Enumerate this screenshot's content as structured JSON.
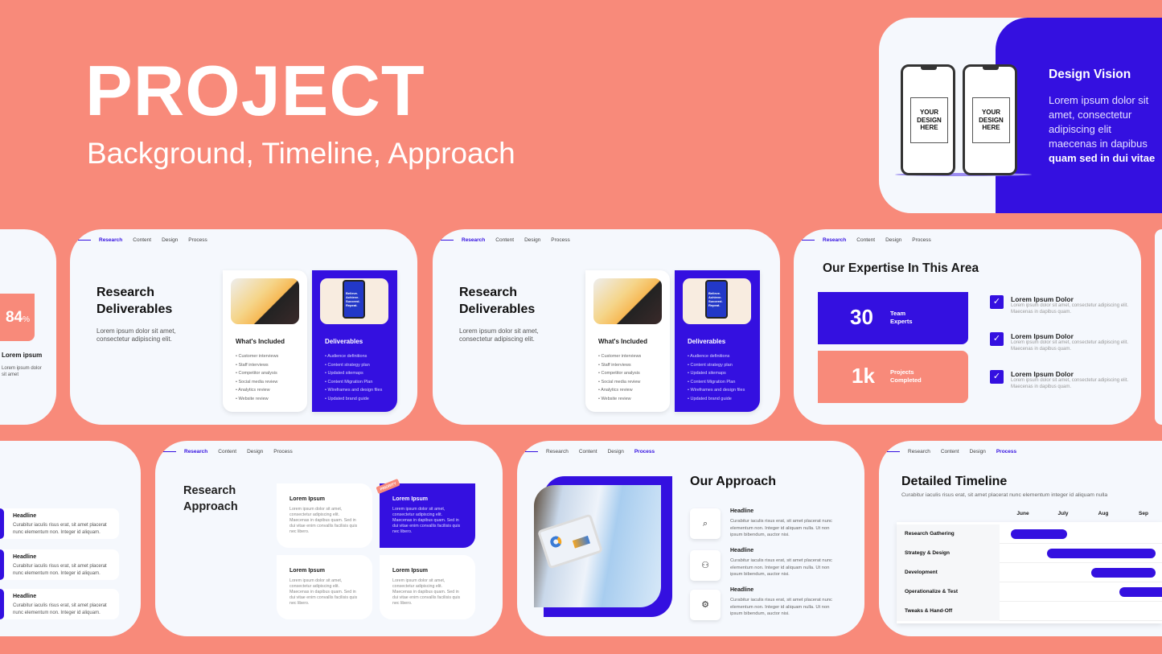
{
  "colors": {
    "background": "#F88A7A",
    "accent": "#3410E0",
    "slide": "#F5F8FD"
  },
  "hero": {
    "title": "PROJECT",
    "subtitle": "Background, Timeline, Approach"
  },
  "nav": {
    "research": "Research",
    "content": "Content",
    "design": "Design",
    "process": "Process"
  },
  "design_vision": {
    "placeholder": "YOUR DESIGN HERE",
    "title": "Design Vision",
    "body": "Lorem ipsum dolor sit amet, consectetur adipiscing elit maecenas in dapibus",
    "body_bold": "quam sed in dui vitae"
  },
  "stat_partial": {
    "value": "84",
    "unit": "%",
    "title": "Lorem ipsum",
    "text": "Lorem ipsum dolor sit amet"
  },
  "deliverables": {
    "title_1": "Research",
    "title_2": "Deliverables",
    "desc": "Lorem ipsum dolor sit amet, consectetur adipiscing elit.",
    "included_title": "What's Included",
    "included": [
      "Customer interviews",
      "Staff interviews",
      "Competitor analysis",
      "Social media review",
      "Analytics review",
      "Website review"
    ],
    "deliverables_title": "Deliverables",
    "phone_text": "Believe. Achieve. Succeed. Repeat.",
    "deliverables": [
      "Audience definitions",
      "Content strategy plan",
      "Updated sitemaps",
      "Content Migration Plan",
      "Wireframes and design files",
      "Updated brand guide"
    ]
  },
  "expertise": {
    "title": "Our Expertise In This Area",
    "stats": [
      {
        "value": "30",
        "label_1": "Team",
        "label_2": "Experts"
      },
      {
        "value": "1k",
        "label_1": "Projects",
        "label_2": "Completed"
      }
    ],
    "items": [
      {
        "title": "Lorem Ipsum Dolor",
        "text": "Lorem ipsum dolor sit amet, consectetur adipiscing elit. Maecenas in dapibus quam."
      },
      {
        "title": "Lorem Ipsum Dolor",
        "text": "Lorem ipsum dolor sit amet, consectetur adipiscing elit. Maecenas in dapibus quam."
      },
      {
        "title": "Lorem Ipsum Dolor",
        "text": "Lorem ipsum dolor sit amet, consectetur adipiscing elit. Maecenas in dapibus quam."
      }
    ]
  },
  "headlines": {
    "title": "Headline",
    "text": "Curabitur iaculis risus erat, sit amet placerat nunc elementum non. Integer id aliquam."
  },
  "approach_grid": {
    "title_1": "Research",
    "title_2": "Approach",
    "priority": "PRIORITY",
    "card_title": "Lorem Ipsum",
    "card_text": "Lorem ipsum dolor sit amet, consectetur adipiscing elit. Maecenas in dapibus quam. Sed in dui vitae enim convallis facilisis quis nec libero."
  },
  "our_approach": {
    "title": "Our Approach",
    "items": [
      {
        "icon": "search-icon",
        "title": "Headline",
        "text": "Curabitur iaculis risus erat, sit amet placerat nunc elementum non. Integer id aliquam nulla. Ut non ipsum bibendum, auctor nisi."
      },
      {
        "icon": "add-user-icon",
        "title": "Headline",
        "text": "Curabitur iaculis risus erat, sit amet placerat nunc elementum non. Integer id aliquam nulla. Ut non ipsum bibendum, auctor nisi."
      },
      {
        "icon": "gear-icon",
        "title": "Headline",
        "text": "Curabitur iaculis risus erat, sit amet placerat nunc elementum non. Integer id aliquam nulla. Ut non ipsum bibendum, auctor nisi."
      }
    ]
  },
  "timeline": {
    "title": "Detailed Timeline",
    "subtitle": "Curabitur iaculis risus erat, sit amet placerat nunc elementum integer id aliquam nulla",
    "months": [
      "June",
      "July",
      "Aug",
      "Sep"
    ],
    "rows": [
      {
        "label": "Research Gathering",
        "start": -0.3,
        "end": 1.1
      },
      {
        "label": "Strategy & Design",
        "start": 0.6,
        "end": 3.3
      },
      {
        "label": "Development",
        "start": 1.7,
        "end": 3.3
      },
      {
        "label": "Operationalize & Test",
        "start": 2.4,
        "end": 3.6
      },
      {
        "label": "Tweaks & Hand-Off",
        "start": null,
        "end": null
      }
    ]
  }
}
